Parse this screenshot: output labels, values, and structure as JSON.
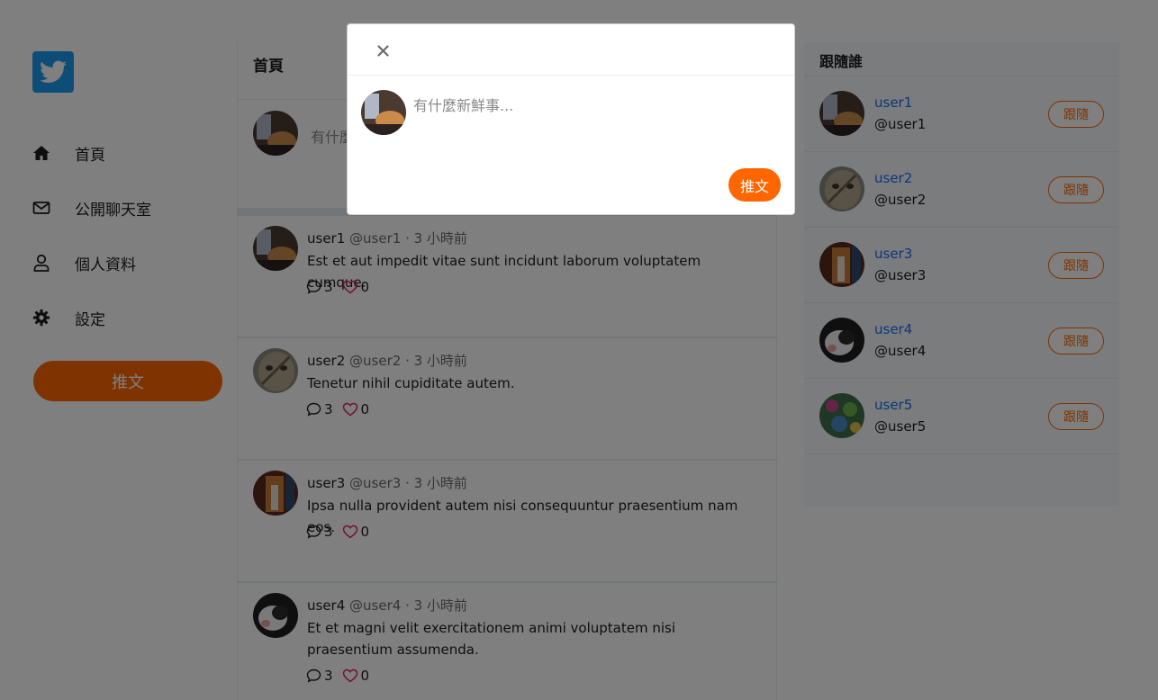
{
  "sidebar": {
    "logo": "twitter-bird-icon",
    "items": [
      {
        "label": "首頁",
        "icon": "home-icon"
      },
      {
        "label": "公開聊天室",
        "icon": "envelope-icon"
      },
      {
        "label": "個人資料",
        "icon": "user-icon"
      },
      {
        "label": "設定",
        "icon": "gear-icon"
      }
    ],
    "tweet_button": "推文"
  },
  "main": {
    "title": "首頁",
    "composer_placeholder": "有什麼新鮮事..."
  },
  "tweets": [
    {
      "name": "user1",
      "handle": "@user1",
      "time": "3 小時前",
      "text": "Est et aut impedit vitae sunt incidunt laborum voluptatem cumque.",
      "replies": "3",
      "likes": "0"
    },
    {
      "name": "user2",
      "handle": "@user2",
      "time": "3 小時前",
      "text": "Tenetur nihil cupiditate autem.",
      "replies": "3",
      "likes": "0"
    },
    {
      "name": "user3",
      "handle": "@user3",
      "time": "3 小時前",
      "text": "Ipsa nulla provident autem nisi consequuntur praesentium nam eos.",
      "replies": "3",
      "likes": "0"
    },
    {
      "name": "user4",
      "handle": "@user4",
      "time": "3 小時前",
      "text": "Et et magni velit exercitationem animi voluptatem nisi praesentium assumenda.",
      "replies": "3",
      "likes": "0"
    }
  ],
  "follow_panel": {
    "title": "跟隨誰",
    "button_label": "跟隨",
    "users": [
      {
        "name": "user1",
        "handle": "@user1"
      },
      {
        "name": "user2",
        "handle": "@user2"
      },
      {
        "name": "user3",
        "handle": "@user3"
      },
      {
        "name": "user4",
        "handle": "@user4"
      },
      {
        "name": "user5",
        "handle": "@user5"
      }
    ]
  },
  "modal": {
    "close_icon": "close-icon",
    "placeholder": "有什麼新鮮事...",
    "submit_label": "推文"
  },
  "colors": {
    "brand_orange": "#ff6600",
    "twitter_blue": "#1d9bf0",
    "link_blue": "#1d6cf0",
    "like_red": "#e0245e"
  }
}
